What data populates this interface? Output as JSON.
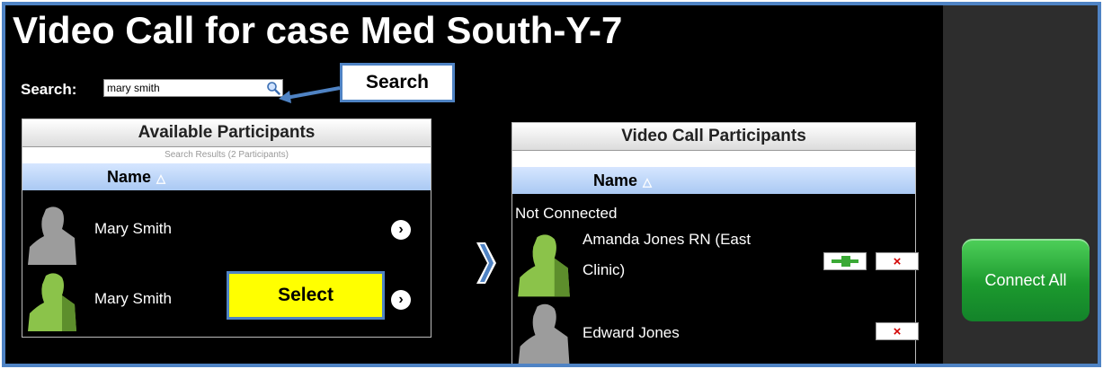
{
  "page": {
    "title": "Video Call for case Med South-Y-7",
    "search_label": "Search:",
    "search_value": "mary smith",
    "callouts": {
      "search": "Search",
      "select": "Select"
    }
  },
  "available_panel": {
    "title": "Available Participants",
    "subtitle": "Search Results (2 Participants)",
    "column": "Name",
    "sort_glyph": "△",
    "rows": [
      {
        "name": "Mary Smith",
        "avatar": "grey",
        "action_icon": "chevron-right-icon",
        "action_glyph": "›"
      },
      {
        "name": "Mary Smith",
        "avatar": "green",
        "action_icon": "chevron-right-icon",
        "action_glyph": "›"
      }
    ]
  },
  "video_panel": {
    "title": "Video Call Participants",
    "subtitle": "",
    "column": "Name",
    "sort_glyph": "△",
    "status_label": "Not Connected",
    "rows": [
      {
        "name_line1": "Amanda Jones RN (East",
        "name_line2": "Clinic)",
        "avatar": "green",
        "actions": [
          "connect-plug-icon",
          "remove-x-icon"
        ]
      },
      {
        "name_line1": "Edward Jones",
        "avatar": "grey",
        "actions": [
          "remove-x-icon"
        ]
      }
    ],
    "remove_glyph": "×"
  },
  "connect_all": {
    "label": "Connect All"
  },
  "colors": {
    "frame_border": "#4f83c4",
    "background": "#000000",
    "sidebar": "#2d2d2d",
    "connect_green": "#1c9a2e",
    "select_highlight": "#ffff00",
    "remove_red": "#d20000"
  }
}
